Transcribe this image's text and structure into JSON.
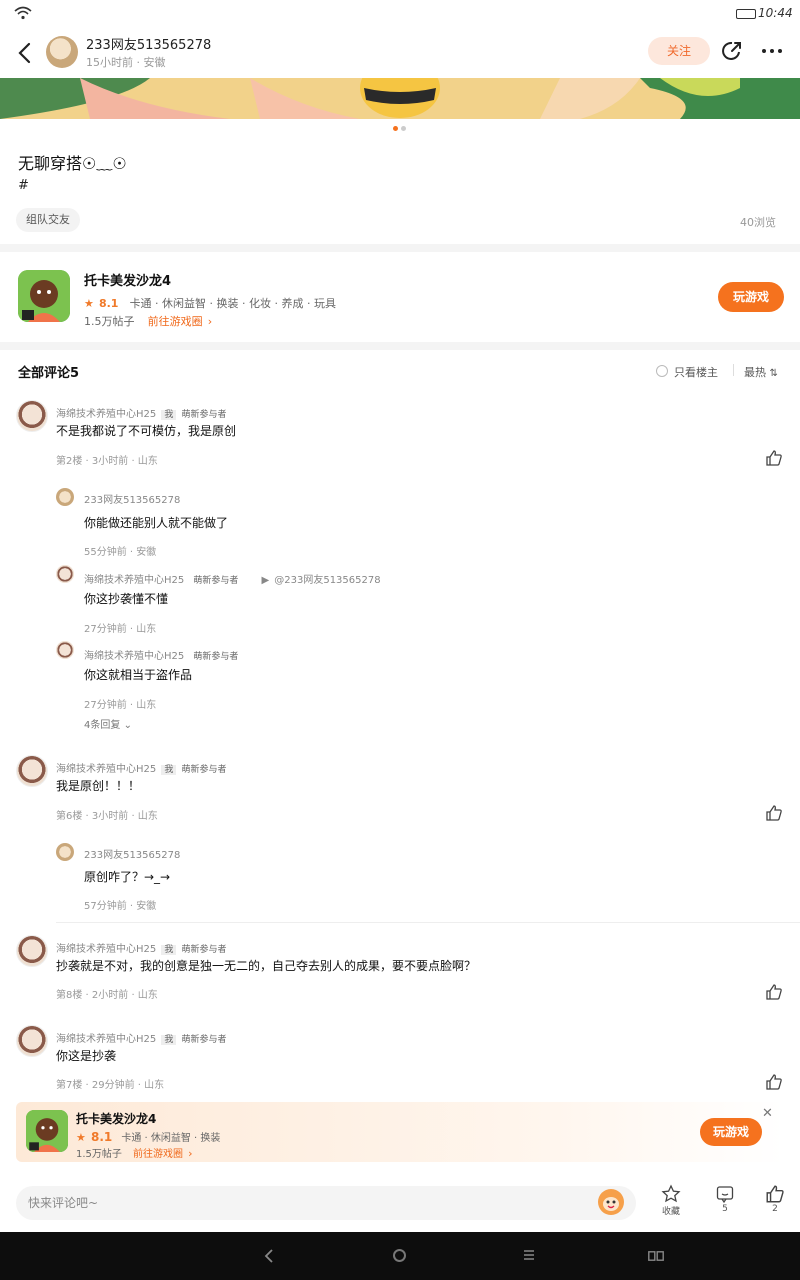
{
  "status": {
    "time": "10:44"
  },
  "header": {
    "author": "233网友513565278",
    "meta": "15小时前 · 安徽",
    "follow_label": "关注"
  },
  "post": {
    "title": "无聊穿搭☉﹏☉",
    "hashtag": "#",
    "tag": "组队交友",
    "views": "40浏览"
  },
  "game": {
    "name": "托卡美发沙龙4",
    "rating": "8.1",
    "tags": "卡通 · 休闲益智 · 换装 · 化妆 · 养成 · 玩具",
    "posts": "1.5万帖子",
    "link": "前往游戏圈",
    "play_label": "玩游戏"
  },
  "comments_header": {
    "title": "全部评论5",
    "only_op": "只看楼主",
    "sort": "最热"
  },
  "comments": [
    {
      "name": "海绵技术养殖中心H25",
      "badge": "我",
      "title": "萌新参与者",
      "text": "不是我都说了不可模仿，我是原创",
      "meta": "第2楼 · 3小时前 · 山东",
      "replies": [
        {
          "name": "233网友513565278",
          "text": "你能做还能别人就不能做了",
          "meta": "55分钟前 · 安徽"
        },
        {
          "name": "海绵技术养殖中心H25",
          "title": "萌新参与者",
          "reply_to": "@233网友513565278",
          "text": "你这抄袭懂不懂",
          "meta": "27分钟前 · 山东"
        },
        {
          "name": "海绵技术养殖中心H25",
          "title": "萌新参与者",
          "text": "你这就相当于盗作品",
          "meta": "27分钟前 · 山东"
        }
      ],
      "expand": "4条回复"
    },
    {
      "name": "海绵技术养殖中心H25",
      "badge": "我",
      "title": "萌新参与者",
      "text": "我是原创！！！",
      "meta": "第6楼 · 3小时前 · 山东",
      "replies": [
        {
          "name": "233网友513565278",
          "text": "原创咋了？→_→",
          "meta": "57分钟前 · 安徽"
        }
      ]
    },
    {
      "name": "海绵技术养殖中心H25",
      "badge": "我",
      "title": "萌新参与者",
      "text": "抄袭就是不对，我的创意是独一无二的，自己夺去别人的成果，要不要点脸啊？",
      "meta": "第8楼 · 2小时前 · 山东"
    },
    {
      "name": "海绵技术养殖中心H25",
      "badge": "我",
      "title": "萌新参与者",
      "text": "你这是抄袭",
      "meta": "第7楼 · 29分钟前 · 山东"
    }
  ],
  "float_card": {
    "name": "托卡美发沙龙4",
    "rating": "8.1",
    "tags": "卡通 · 休闲益智 · 换装",
    "posts": "1.5万帖子",
    "link": "前往游戏圈",
    "play_label": "玩游戏"
  },
  "bottom": {
    "placeholder": "快来评论吧~",
    "favorite_label": "收藏",
    "comment_count": "5",
    "like_count": "2"
  },
  "colors": {
    "accent": "#f5721e",
    "follow_bg": "#fde7dc"
  }
}
